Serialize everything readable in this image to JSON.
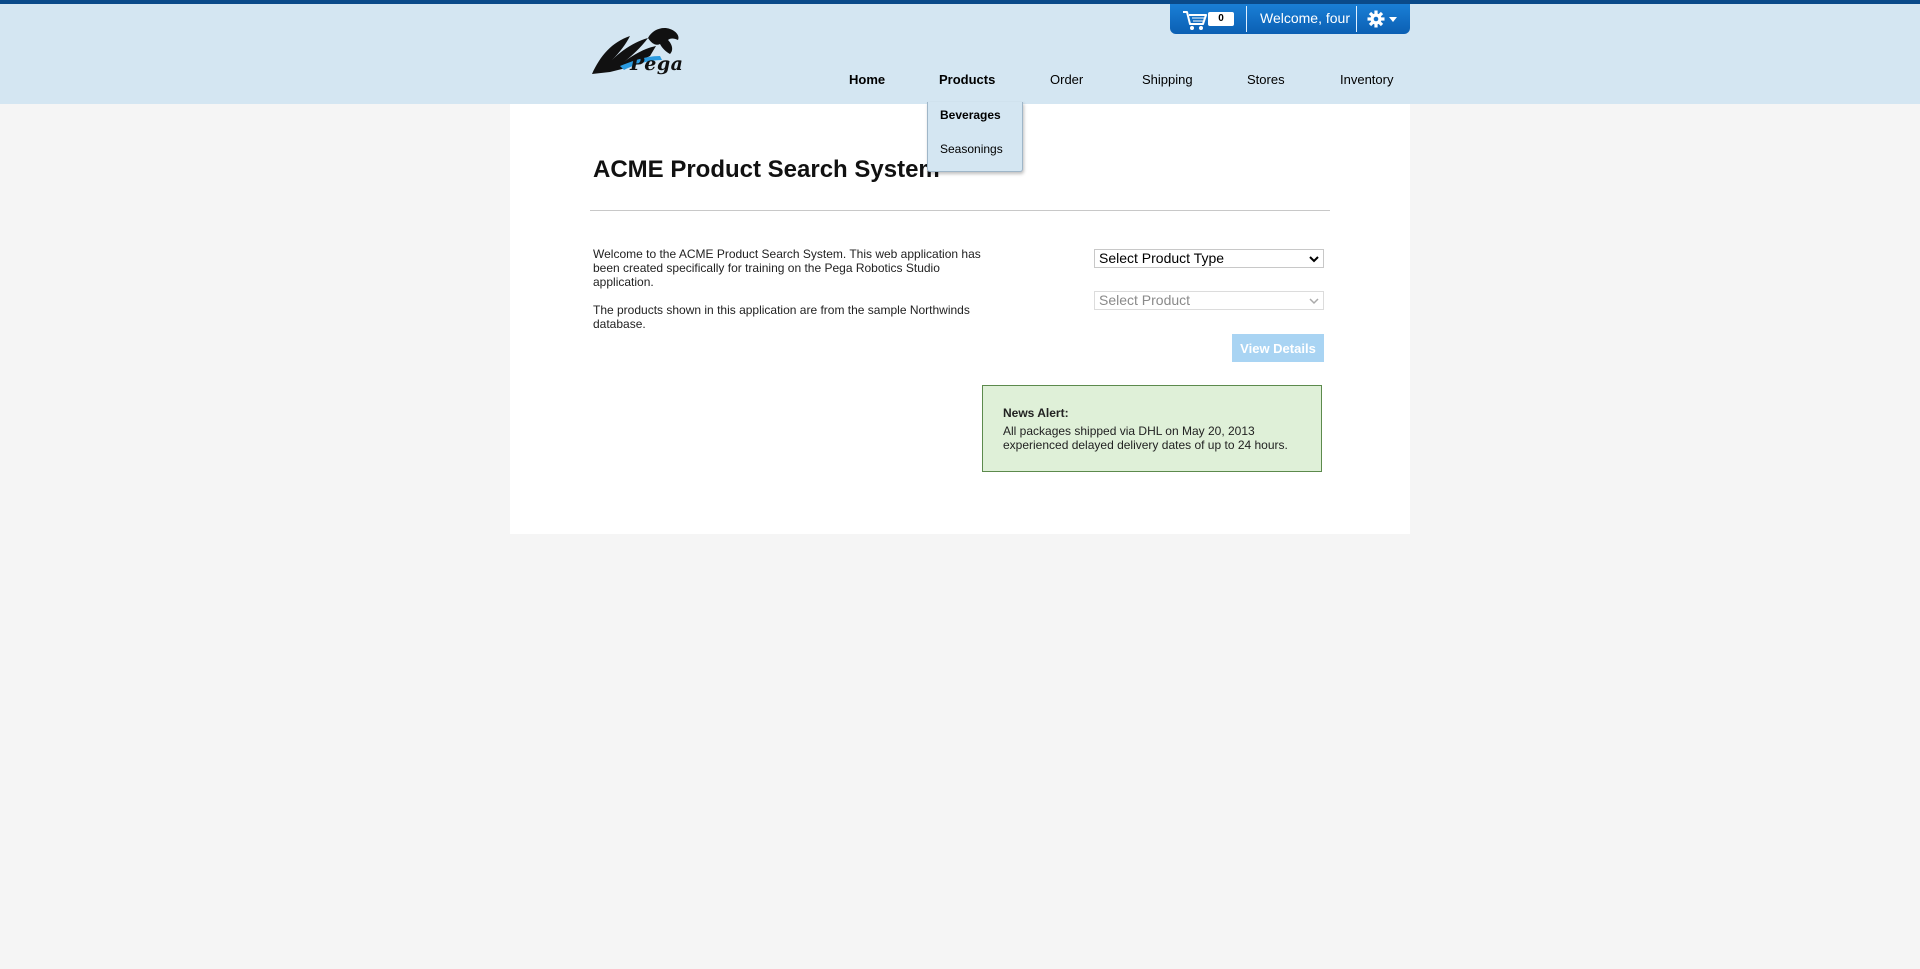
{
  "header": {
    "logo_text": "Pega",
    "cart_count": "0",
    "welcome_text": "Welcome, four"
  },
  "nav": {
    "items": [
      {
        "label": "Home"
      },
      {
        "label": "Products"
      },
      {
        "label": "Order"
      },
      {
        "label": "Shipping"
      },
      {
        "label": "Stores"
      },
      {
        "label": "Inventory"
      }
    ]
  },
  "products_menu": {
    "items": [
      {
        "label": "Beverages"
      },
      {
        "label": "Seasonings"
      }
    ]
  },
  "main": {
    "title": "ACME Product Search System",
    "intro_1": "Welcome to the ACME Product Search System. This web application has been created specifically for training on the Pega Robotics Studio application.",
    "intro_2": "The products shown in this application are from the sample Northwinds database.",
    "product_type_select": "Select Product Type",
    "product_select": "Select Product",
    "view_details_label": "View Details"
  },
  "news": {
    "title": "News Alert:",
    "body": "All packages shipped via DHL on May 20, 2013 experienced delayed delivery dates of up to 24 hours."
  },
  "colors": {
    "header_bg": "#d4e6f2",
    "userbar_bg": "#0b5fb3",
    "news_bg": "#dff0d8",
    "button_disabled": "#a9d4f3"
  }
}
